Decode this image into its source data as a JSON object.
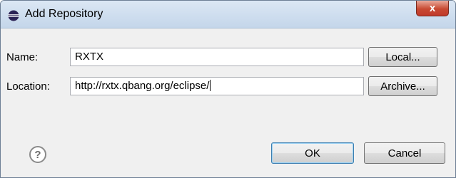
{
  "window": {
    "title": "Add Repository",
    "close_glyph": "x",
    "app_icon": "eclipse-icon"
  },
  "form": {
    "name_label": "Name:",
    "name_value": "RXTX",
    "location_label": "Location:",
    "location_value": "http://rxtx.qbang.org/eclipse/"
  },
  "buttons": {
    "local": "Local...",
    "archive": "Archive...",
    "ok": "OK",
    "cancel": "Cancel"
  },
  "help": {
    "glyph": "?",
    "icon": "help-icon"
  },
  "colors": {
    "close_button": "#c84a33",
    "default_button_border": "#3c7fb1"
  }
}
